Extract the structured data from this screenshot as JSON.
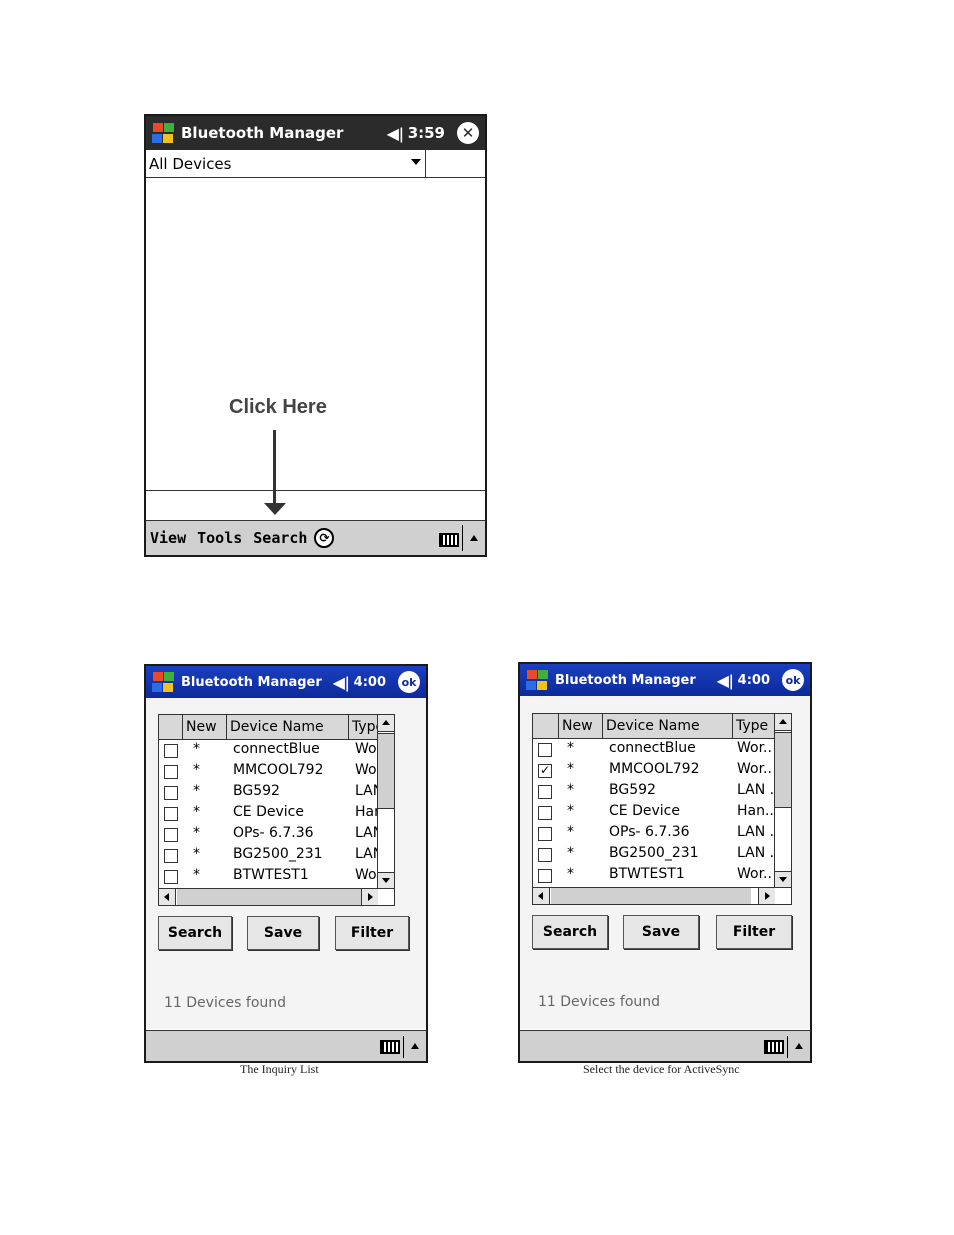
{
  "screen1": {
    "title": "Bluetooth Manager",
    "time": "3:59",
    "dropdown_value": "All Devices",
    "menu": [
      "View",
      "Tools",
      "Search"
    ],
    "callout": "Click Here"
  },
  "screen2": {
    "title": "Bluetooth Manager",
    "time": "4:00",
    "ok_label": "ok",
    "columns": [
      "New",
      "Device Name",
      "Type"
    ],
    "rows": [
      {
        "new": "*",
        "name": "connectBlue",
        "type": "Wor..",
        "checked": false
      },
      {
        "new": "*",
        "name": "MMCOOL792",
        "type": "Wor..",
        "checked": false
      },
      {
        "new": "*",
        "name": "BG592",
        "type": "LAN .",
        "checked": false
      },
      {
        "new": "*",
        "name": "CE Device",
        "type": "Han..",
        "checked": false
      },
      {
        "new": "*",
        "name": "OPs- 6.7.36",
        "type": "LAN .",
        "checked": false
      },
      {
        "new": "*",
        "name": "BG2500_231",
        "type": "LAN .",
        "checked": false
      },
      {
        "new": "*",
        "name": "BTWTEST1",
        "type": "Wor..",
        "checked": false
      }
    ],
    "buttons": {
      "search": "Search",
      "save": "Save",
      "filter": "Filter"
    },
    "status": "11 Devices found",
    "caption": "The Inquiry List"
  },
  "screen3": {
    "title": "Bluetooth Manager",
    "time": "4:00",
    "ok_label": "ok",
    "columns": [
      "New",
      "Device Name",
      "Type"
    ],
    "rows": [
      {
        "new": "*",
        "name": "connectBlue",
        "type": "Wor..",
        "checked": false
      },
      {
        "new": "*",
        "name": "MMCOOL792",
        "type": "Wor..",
        "checked": true
      },
      {
        "new": "*",
        "name": "BG592",
        "type": "LAN .",
        "checked": false
      },
      {
        "new": "*",
        "name": "CE Device",
        "type": "Han..",
        "checked": false
      },
      {
        "new": "*",
        "name": "OPs- 6.7.36",
        "type": "LAN .",
        "checked": false
      },
      {
        "new": "*",
        "name": "BG2500_231",
        "type": "LAN .",
        "checked": false
      },
      {
        "new": "*",
        "name": "BTWTEST1",
        "type": "Wor..",
        "checked": false
      }
    ],
    "buttons": {
      "search": "Search",
      "save": "Save",
      "filter": "Filter"
    },
    "status": "11 Devices found",
    "caption": "Select the device for ActiveSync"
  },
  "icons": {
    "close": "close-icon",
    "ok": "ok-icon",
    "speaker": "speaker-icon",
    "keyboard": "keyboard-icon",
    "sync": "sync-icon",
    "start": "windows-logo-icon"
  },
  "colors": {
    "title_dark": "#2b2b2b",
    "title_blue": "#0c2a9a",
    "menubar": "#d0d0d0"
  }
}
